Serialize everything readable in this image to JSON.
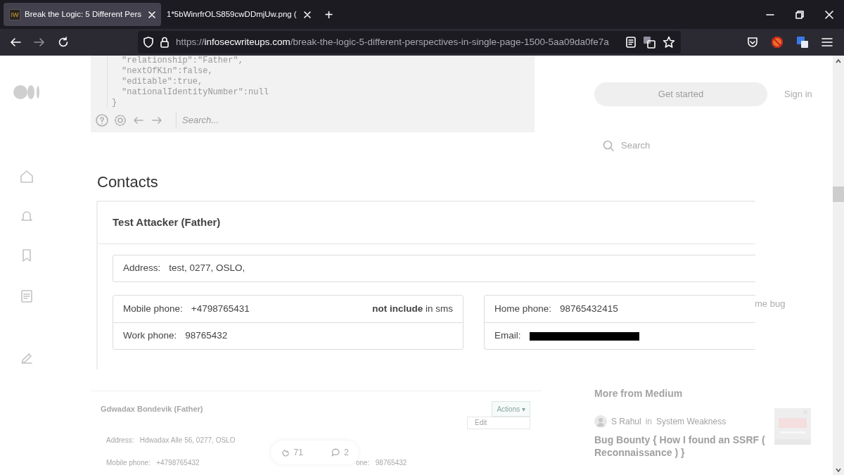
{
  "browser": {
    "tabs": [
      {
        "favicon": "IW",
        "title": "Break the Logic: 5 Different Pers",
        "selected": true
      },
      {
        "title": "1*5bWinrfrOLS859cwDDmjUw.png (",
        "selected": false
      }
    ],
    "new_tab": "+",
    "url": {
      "scheme": "https://",
      "host": "infosecwriteups.com",
      "path": "/break-the-logic-5-different-perspectives-in-single-page-1500-5aa09da0fe7a"
    },
    "forward_disabled": true
  },
  "background_page": {
    "code_lines": [
      "\"relationship\":\"Father\",",
      "\"nextOfKin\":false,",
      "\"editable\":true,",
      "\"nationalIdentityNumber\":null",
      "}"
    ],
    "code_search_placeholder": "Search...",
    "get_started": "Get started",
    "sign_in": "Sign in",
    "search_placeholder": "Search",
    "fragment": "me bug",
    "more_heading": "More from Medium",
    "story": {
      "author": "S Rahul",
      "joiner": "in",
      "publication": "System Weakness",
      "title": "Bug Bounty { How I found an SSRF ( Reconnaissance ) }"
    },
    "contact_card": {
      "name": "Gdwadax Bondevik (Father)",
      "actions": "Actions ▾",
      "menu_item": "Edit",
      "address": "Address:   Hdwadax Alle 56, 0277, OSLO",
      "mobile": "Mobile phone:   +4798765432",
      "other": "one:   98765432"
    },
    "claps": "71",
    "responses": "2"
  },
  "image": {
    "heading": "Contacts",
    "contact": {
      "name": "Test Attacker (Father)",
      "address_label": "Address:",
      "address": "test, 0277, OSLO,",
      "left_fields": [
        {
          "label": "Mobile phone:",
          "value": "+4798765431",
          "note": "**not include** in sms"
        },
        {
          "label": "Work phone:",
          "value": "98765432"
        }
      ],
      "right_fields": [
        {
          "label": "Home phone:",
          "value": "98765432415",
          "redacted": false
        },
        {
          "label": "Email:",
          "redacted": true
        }
      ]
    }
  }
}
